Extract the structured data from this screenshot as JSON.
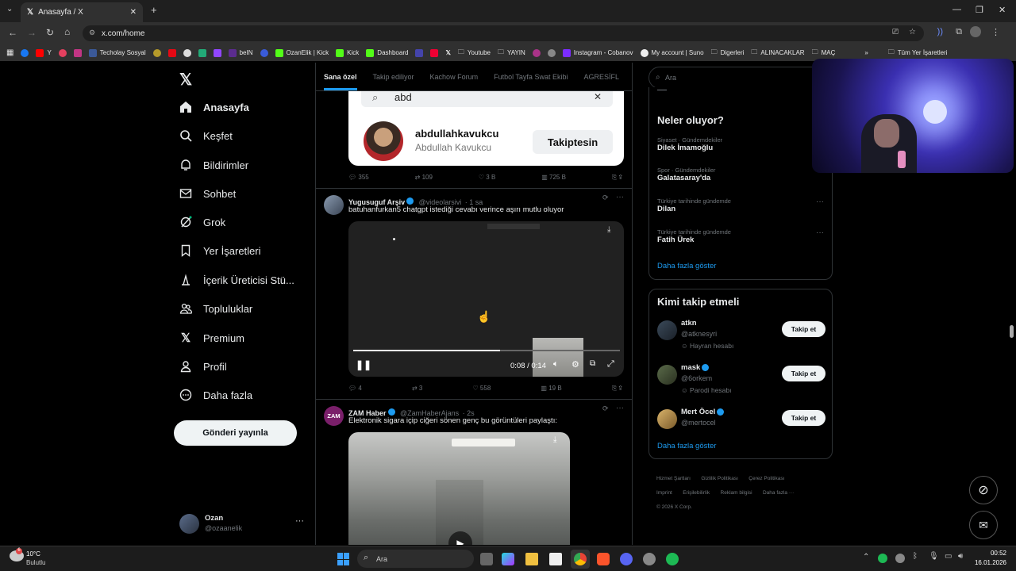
{
  "browser": {
    "tab_title": "Anasayfa / X",
    "url": "x.com/home",
    "bookmarks": [
      "Y",
      "Techolay Sosyal",
      "beIN",
      "OzanElik | Kick",
      "Kick",
      "Dashboard",
      "Youtube",
      "YAYIN",
      "Instagram - Cobanov",
      "My account | Suno",
      "Digerleri",
      "ALINACAKLAR",
      "MAÇ"
    ],
    "all_bookmarks": "Tüm Yer İşaretleri"
  },
  "sidebar": {
    "items": [
      {
        "label": "Anasayfa"
      },
      {
        "label": "Keşfet"
      },
      {
        "label": "Bildirimler"
      },
      {
        "label": "Sohbet"
      },
      {
        "label": "Grok"
      },
      {
        "label": "Yer İşaretleri"
      },
      {
        "label": "İçerik Üreticisi Stü..."
      },
      {
        "label": "Topluluklar"
      },
      {
        "label": "Premium"
      },
      {
        "label": "Profil"
      },
      {
        "label": "Daha fazla"
      }
    ],
    "post_button": "Gönderi yayınla",
    "account": {
      "name": "Ozan",
      "handle": "@ozaanelik"
    }
  },
  "feed": {
    "tabs": [
      "Sana özel",
      "Takip ediliyor",
      "Kachow Forum",
      "Futbol Tayfa Swat Ekibi",
      "AGRESİFL"
    ],
    "first_post": {
      "search_text": "abd",
      "result_username": "abdullahkavukcu",
      "result_name": "Abdullah Kavukcu",
      "result_button": "Takiptesin",
      "replies": "355",
      "reposts": "109",
      "likes": "3 B",
      "views": "725 B"
    },
    "posts": [
      {
        "name": "Yugusuguf Arşiv",
        "handle": "@videolarsivi",
        "time": "· 1 sa",
        "text": "batuhanfurkan5 chatgpt istediği cevabı verince aşırı mutlu oluyor",
        "video_time": "0:08 / 0:14",
        "video_progress": 0.55,
        "replies": "4",
        "reposts": "3",
        "likes": "558",
        "views": "19 B"
      },
      {
        "name": "ZAM Haber",
        "handle": "@ZamHaberAjans",
        "time": "· 2s",
        "avatar_text": "ZAM",
        "text": "Elektronik sigara içip ciğeri sönen genç bu görüntüleri paylaştı:"
      }
    ]
  },
  "right": {
    "search_placeholder": "Ara",
    "trends_title": "Neler oluyor?",
    "trends": [
      {
        "category": "Siyaset · Gündemdekiler",
        "name": "Dilek İmamoğlu"
      },
      {
        "category": "Spor · Gündemdekiler",
        "name": "Galatasaray'da"
      },
      {
        "category": "Türkiye tarihinde gündemde",
        "name": "Dilan"
      },
      {
        "category": "Türkiye tarihinde gündemde",
        "name": "Fatih Ürek"
      }
    ],
    "show_more": "Daha fazla göster",
    "who_title": "Kimi takip etmeli",
    "who": [
      {
        "name": "atkn",
        "handle": "@atknesyri",
        "note": "Hayran hesabı",
        "button": "Takip et"
      },
      {
        "name": "mask",
        "handle": "@6orkem",
        "note": "Parodi hesabı",
        "button": "Takip et"
      },
      {
        "name": "Mert Öcel",
        "handle": "@mertocel",
        "note": "",
        "button": "Takip et"
      }
    ],
    "footer": [
      "Hizmet Şartları",
      "Gizlilik Politikası",
      "Çerez Politikası",
      "Imprint",
      "Erişilebilirlik",
      "Reklam bilgisi",
      "Daha fazla ···",
      "© 2026 X Corp."
    ]
  },
  "taskbar": {
    "temp": "10°C",
    "weather": "Bulutlu",
    "search": "Ara",
    "time": "00:52",
    "date": "16.01.2026"
  }
}
